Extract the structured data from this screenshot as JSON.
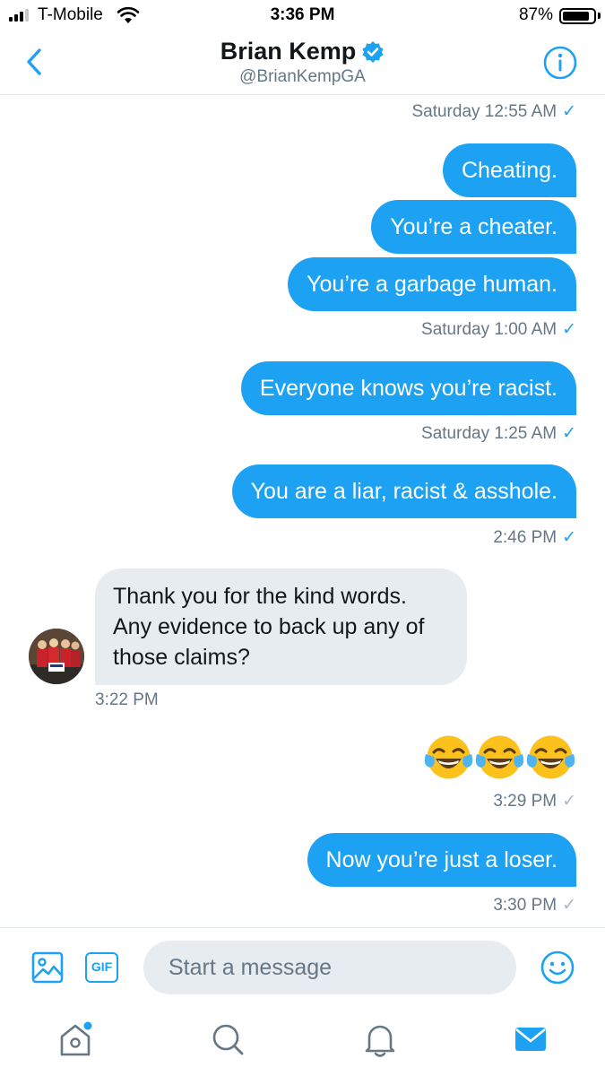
{
  "status_bar": {
    "carrier": "T-Mobile",
    "time": "3:36 PM",
    "battery_percent": "87%",
    "battery_level": 0.87,
    "signal_bars": 3,
    "signal_bars_total": 4
  },
  "header": {
    "title": "Brian Kemp",
    "handle": "@BrianKempGA",
    "verified": true,
    "back_icon": "chevron-left-icon",
    "info_icon": "info-circle-icon"
  },
  "messages": [
    {
      "type": "timestamp",
      "text": "Saturday 12:55 AM",
      "status": "read"
    },
    {
      "type": "sent",
      "text": "Cheating."
    },
    {
      "type": "sent",
      "text": "You’re a cheater."
    },
    {
      "type": "sent",
      "text": "You’re a garbage human."
    },
    {
      "type": "timestamp",
      "text": "Saturday 1:00 AM",
      "status": "read"
    },
    {
      "type": "sent",
      "text": "Everyone knows you’re racist."
    },
    {
      "type": "timestamp",
      "text": "Saturday 1:25 AM",
      "status": "read"
    },
    {
      "type": "sent",
      "text": "You are a liar, racist & asshole."
    },
    {
      "type": "timestamp",
      "text": "2:46 PM",
      "status": "read"
    },
    {
      "type": "received",
      "text": "Thank you for the kind words. Any evidence to back up any of those claims?"
    },
    {
      "type": "timestamp",
      "text": "3:22 PM"
    },
    {
      "type": "sent-emoji",
      "emoji": "😂😂😂",
      "count": 3
    },
    {
      "type": "timestamp",
      "text": "3:29 PM",
      "status": "sent"
    },
    {
      "type": "sent",
      "text": "Now you’re just a loser."
    },
    {
      "type": "timestamp",
      "text": "3:30 PM",
      "status": "sent"
    }
  ],
  "composer": {
    "placeholder": "Start a message",
    "gif_label": "GIF",
    "image_icon": "image-icon",
    "emoji_icon": "smiley-icon"
  },
  "tabbar": {
    "items": [
      "home-icon",
      "search-icon",
      "bell-icon",
      "mail-icon"
    ],
    "active": "mail-icon",
    "home_has_notification_dot": true
  },
  "colors": {
    "accent": "#1da1f2",
    "bubble_in": "#e6ecf0",
    "secondary_text": "#657786",
    "read_check": "#1da1f2",
    "sent_check": "#aab8c2"
  }
}
